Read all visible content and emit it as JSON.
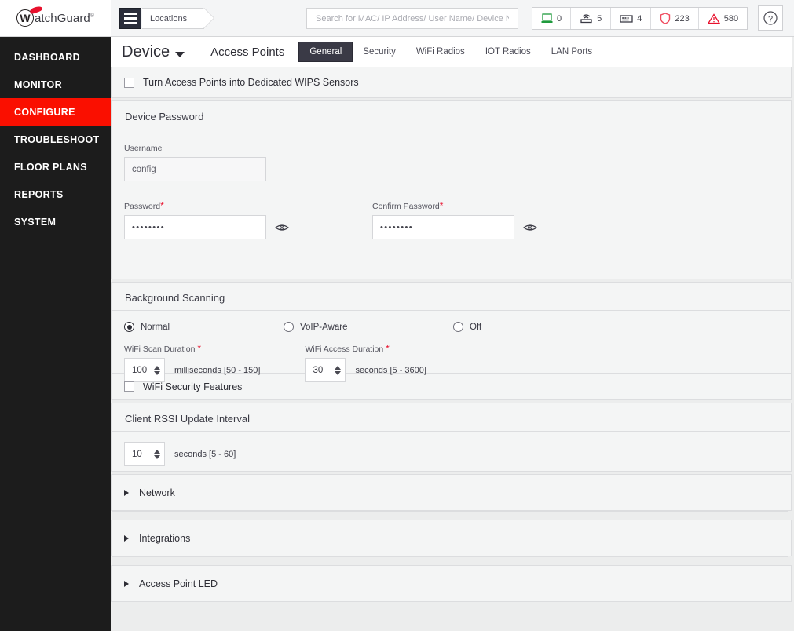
{
  "brand": {
    "logo_initial": "W",
    "logo_text": "atchGuard",
    "logo_tm": "®"
  },
  "topbar": {
    "menu_icon": "hamburger-icon",
    "breadcrumb": "Locations",
    "search": {
      "placeholder": "Search for MAC/ IP Address/ User Name/ Device Name...",
      "value": ""
    },
    "counters": [
      {
        "icon": "laptop-icon",
        "value": "0",
        "color": "#1f9a3d"
      },
      {
        "icon": "access-point-icon",
        "value": "5",
        "color": "#3a3a44"
      },
      {
        "icon": "device-grid-icon",
        "value": "4",
        "color": "#3a3a44"
      },
      {
        "icon": "shield-icon",
        "value": "223",
        "color": "#ef4b5e"
      },
      {
        "icon": "warning-triangle-icon",
        "value": "580",
        "color": "#e8112d"
      }
    ],
    "help_label": "?"
  },
  "sidebar": {
    "active": "CONFIGURE",
    "items": [
      {
        "label": "DASHBOARD"
      },
      {
        "label": "MONITOR"
      },
      {
        "label": "CONFIGURE"
      },
      {
        "label": "TROUBLESHOOT"
      },
      {
        "label": "FLOOR PLANS"
      },
      {
        "label": "REPORTS"
      },
      {
        "label": "SYSTEM"
      }
    ]
  },
  "tabbar": {
    "device_menu": "Device",
    "access_points": "Access Points",
    "subtabs": [
      {
        "label": "General",
        "active": true
      },
      {
        "label": "Security",
        "active": false
      },
      {
        "label": "WiFi Radios",
        "active": false
      },
      {
        "label": "IOT Radios",
        "active": false
      },
      {
        "label": "LAN Ports",
        "active": false
      }
    ]
  },
  "main": {
    "wips_checkbox": {
      "label": "Turn Access Points into Dedicated WIPS Sensors",
      "checked": false
    },
    "device_password": {
      "title": "Device Password",
      "username_label": "Username",
      "username_value": "config",
      "password_label": "Password",
      "password_required": "*",
      "password_value": "••••••••",
      "confirm_label": "Confirm Password",
      "confirm_required": "*",
      "confirm_value": "••••••••"
    },
    "background_scanning": {
      "title": "Background Scanning",
      "options": [
        {
          "label": "Normal",
          "selected": true
        },
        {
          "label": "VoIP-Aware",
          "selected": false
        },
        {
          "label": "Off",
          "selected": false
        }
      ],
      "scan_duration_label": "WiFi Scan Duration",
      "scan_duration_required": "*",
      "scan_duration_value": "100",
      "scan_duration_hint": "milliseconds [50 - 150]",
      "access_duration_label": "WiFi Access Duration",
      "access_duration_required": "*",
      "access_duration_value": "30",
      "access_duration_hint": "seconds [5 - 3600]"
    },
    "wifi_security": {
      "label": "WiFi Security Features",
      "checked": false
    },
    "client_rssi": {
      "title": "Client RSSI Update Interval",
      "value": "10",
      "hint": "seconds [5 - 60]"
    },
    "accordions": [
      {
        "label": "Network"
      },
      {
        "label": "Integrations"
      },
      {
        "label": "Access Point LED"
      }
    ]
  }
}
